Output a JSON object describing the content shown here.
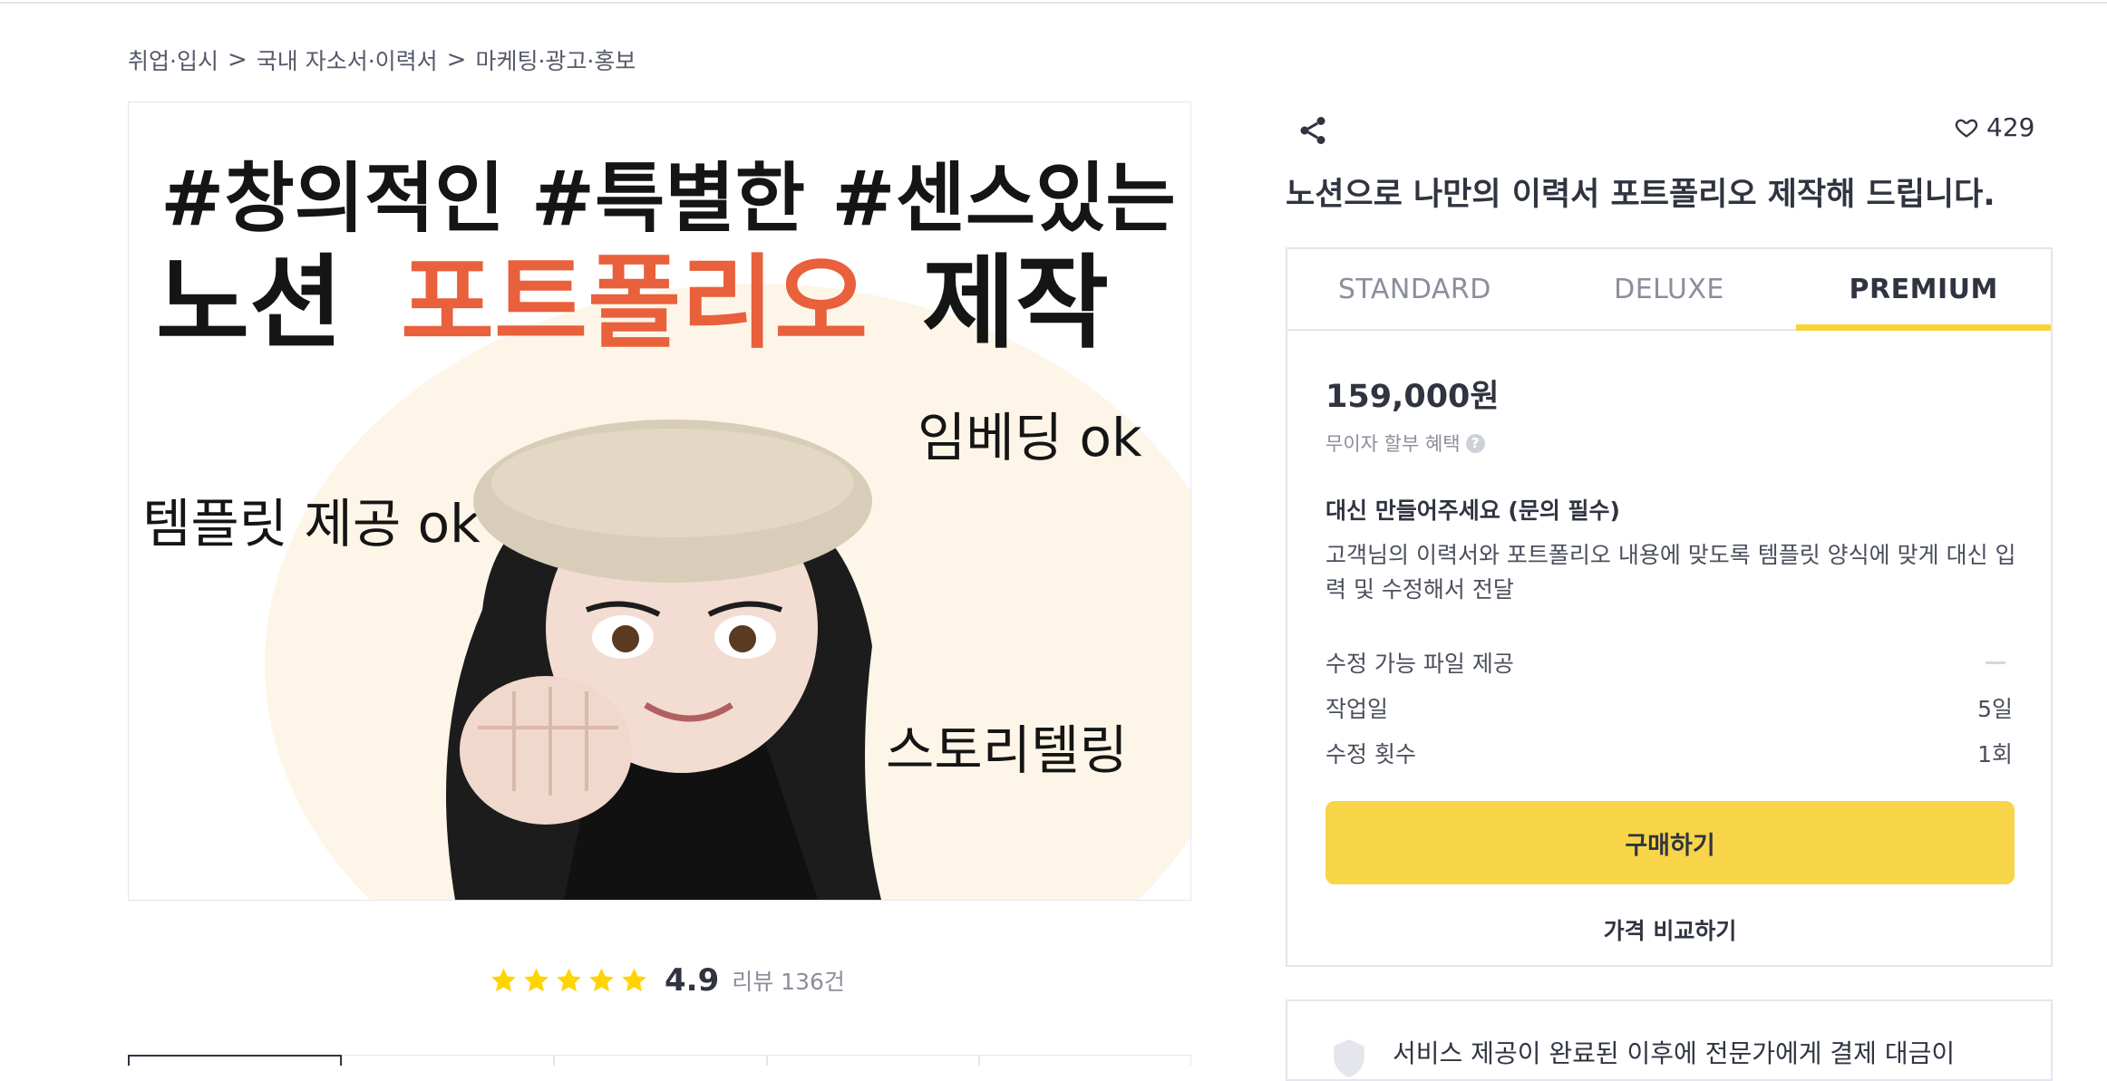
{
  "breadcrumb": [
    {
      "label": "취업·입시"
    },
    {
      "label": "국내 자소서·이력서"
    },
    {
      "label": "마케팅·광고·홍보"
    }
  ],
  "breadcrumb_separator": ">",
  "hero": {
    "line1": "#창의적인 #특별한 #센스있는",
    "line2_a": "노션",
    "line2_b": "포트폴리오",
    "line2_c": "제작",
    "tag_embed": "임베딩 ok",
    "tag_template": "템플릿 제공 ok",
    "tag_story": "스토리텔링",
    "accent_color": "#e8603c"
  },
  "rating": {
    "stars": 5,
    "score": "4.9",
    "reviews": "리뷰 136건",
    "star_color": "#ffd400"
  },
  "share_icon": "share-icon",
  "like": {
    "icon": "heart-outline-icon",
    "count": "429"
  },
  "title": "노션으로 나만의 이력서 포트폴리오 제작해 드립니다.",
  "packages": {
    "tabs": [
      {
        "label": "STANDARD",
        "active": false
      },
      {
        "label": "DELUXE",
        "active": false
      },
      {
        "label": "PREMIUM",
        "active": true
      }
    ],
    "price": "159,000원",
    "installment": "무이자 할부 혜택",
    "installment_help": "?",
    "name": "대신 만들어주세요 (문의 필수)",
    "description": "고객님의 이력서와 포트폴리오 내용에  맞도록 템플릿 양식에 맞게 대신 입력 및 수정해서 전달",
    "options": [
      {
        "label": "수정 가능 파일 제공",
        "value": ""
      },
      {
        "label": "작업일",
        "value": "5일"
      },
      {
        "label": "수정 횟수",
        "value": "1회"
      }
    ],
    "buy_label": "구매하기",
    "compare_label": "가격 비교하기",
    "accent_color": "#f8d548"
  },
  "notice": {
    "icon": "shield-icon",
    "text": "서비스 제공이 완료된 이후에 전문가에게 결제 대금이"
  }
}
